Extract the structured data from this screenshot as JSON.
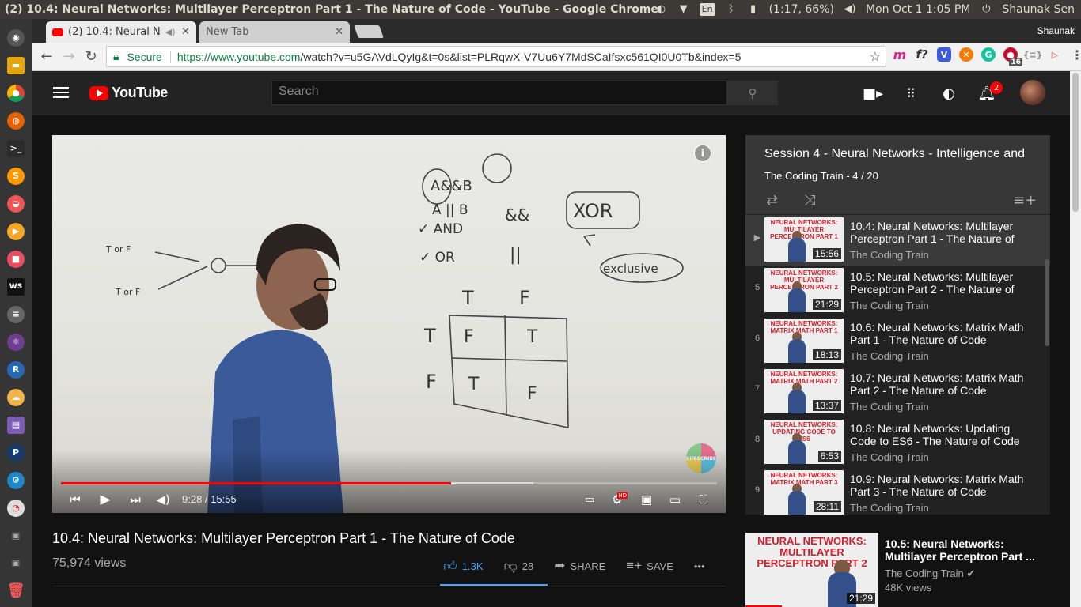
{
  "os": {
    "window_title": "(2) 10.4: Neural Networks: Multilayer Perceptron Part 1 - The Nature of Code - YouTube - Google Chrome",
    "battery": "(1:17, 66%)",
    "datetime": "Mon Oct  1  1:05 PM",
    "user": "Shaunak Sen",
    "kbd": "En"
  },
  "browser": {
    "tabs": [
      {
        "label": "(2) 10.4: Neural N"
      },
      {
        "label": "New Tab"
      }
    ],
    "profile": "Shaunak",
    "secure_label": "Secure",
    "url_host": "https://www.youtube.com",
    "url_rest": "/watch?v=u5GAVdLQyIg&t=0s&list=PLRqwX-V7Uu6Y7MdSCaIfsxc561QI0U0Tb&index=5",
    "ext_badge": "16"
  },
  "youtube": {
    "logo_text": "YouTube",
    "search_placeholder": "Search",
    "notif_count": "2",
    "player": {
      "time": "9:28 / 15:55",
      "played_fraction": 0.595,
      "buffered_fraction": 0.72,
      "subscribe_text": "SUBSCRIBE",
      "hd_badge": "HD",
      "info": "i"
    },
    "video": {
      "title": "10.4: Neural Networks: Multilayer Perceptron Part 1 - The Nature of Code",
      "views": "75,974 views",
      "likes": "1.3K",
      "dislikes": "28",
      "share": "SHARE",
      "save": "SAVE",
      "more": "•••"
    },
    "playlist": {
      "title": "Session 4 - Neural Networks - Intelligence and",
      "channel": "The Coding Train",
      "position": " - 4 / 20",
      "items": [
        {
          "index": "▶",
          "title": "10.4: Neural Networks: Multilayer Perceptron Part 1 - The Nature of",
          "channel": "The Coding Train",
          "duration": "15:56",
          "thumb": "NEURAL NETWORKS: MULTILAYER PERCEPTRON PART 1"
        },
        {
          "index": "5",
          "title": "10.5: Neural Networks: Multilayer Perceptron Part 2 - The Nature of",
          "channel": "The Coding Train",
          "duration": "21:29",
          "thumb": "NEURAL NETWORKS: MULTILAYER PERCEPTRON PART 2"
        },
        {
          "index": "6",
          "title": "10.6: Neural Networks: Matrix Math Part 1 - The Nature of Code",
          "channel": "The Coding Train",
          "duration": "18:13",
          "thumb": "NEURAL NETWORKS: MATRIX MATH PART 1"
        },
        {
          "index": "7",
          "title": "10.7: Neural Networks: Matrix Math Part 2 - The Nature of Code",
          "channel": "The Coding Train",
          "duration": "13:37",
          "thumb": "NEURAL NETWORKS: MATRIX MATH PART 2"
        },
        {
          "index": "8",
          "title": "10.8: Neural Networks: Updating Code to ES6 - The Nature of Code",
          "channel": "The Coding Train",
          "duration": "6:53",
          "thumb": "NEURAL NETWORKS: UPDATING CODE TO ES6"
        },
        {
          "index": "9",
          "title": "10.9: Neural Networks: Matrix Math Part 3 - The Nature of Code",
          "channel": "The Coding Train",
          "duration": "28:11",
          "thumb": "NEURAL NETWORKS: MATRIX MATH PART 3"
        }
      ]
    },
    "up_next": {
      "title": "10.5: Neural Networks: Multilayer Perceptron Part ...",
      "channel": "The Coding Train ✔",
      "views": "48K views",
      "duration": "21:29",
      "thumb": "NEURAL NETWORKS: MULTILAYER PERCEPTRON PART 2"
    }
  },
  "whiteboard": {
    "a1": "A&&B",
    "a2": "A || B",
    "and": "✓ AND",
    "or": "✓ OR",
    "and_op": "&&",
    "or_op": "||",
    "xor": "XOR",
    "exclusive": "exclusive",
    "tf1": "T or F",
    "tf2": "T or F",
    "t": "T",
    "f": "F"
  },
  "colors": {
    "accent": "#ff0000",
    "link": "#3ea6ff",
    "secure": "#0b8043"
  }
}
